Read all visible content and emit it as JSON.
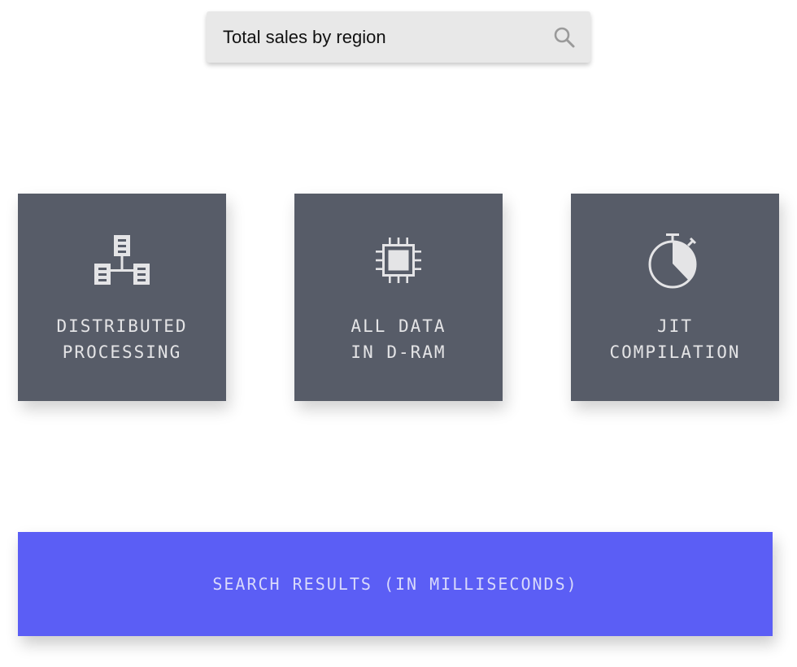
{
  "search": {
    "value": "Total sales by region",
    "icon": "search-icon"
  },
  "features": [
    {
      "icon": "distributed-servers-icon",
      "lines": [
        "DISTRIBUTED",
        "PROCESSING"
      ]
    },
    {
      "icon": "chip-icon",
      "lines": [
        "ALL DATA",
        "IN D-RAM"
      ]
    },
    {
      "icon": "stopwatch-icon",
      "lines": [
        "JIT",
        "COMPILATION"
      ]
    }
  ],
  "results": {
    "label": "SEARCH RESULTS (IN MILLISECONDS)"
  },
  "colors": {
    "card_bg": "#575c68",
    "card_text": "#e4e4e6",
    "accent": "#5b5ef5",
    "search_bg": "#e8e8e8"
  }
}
